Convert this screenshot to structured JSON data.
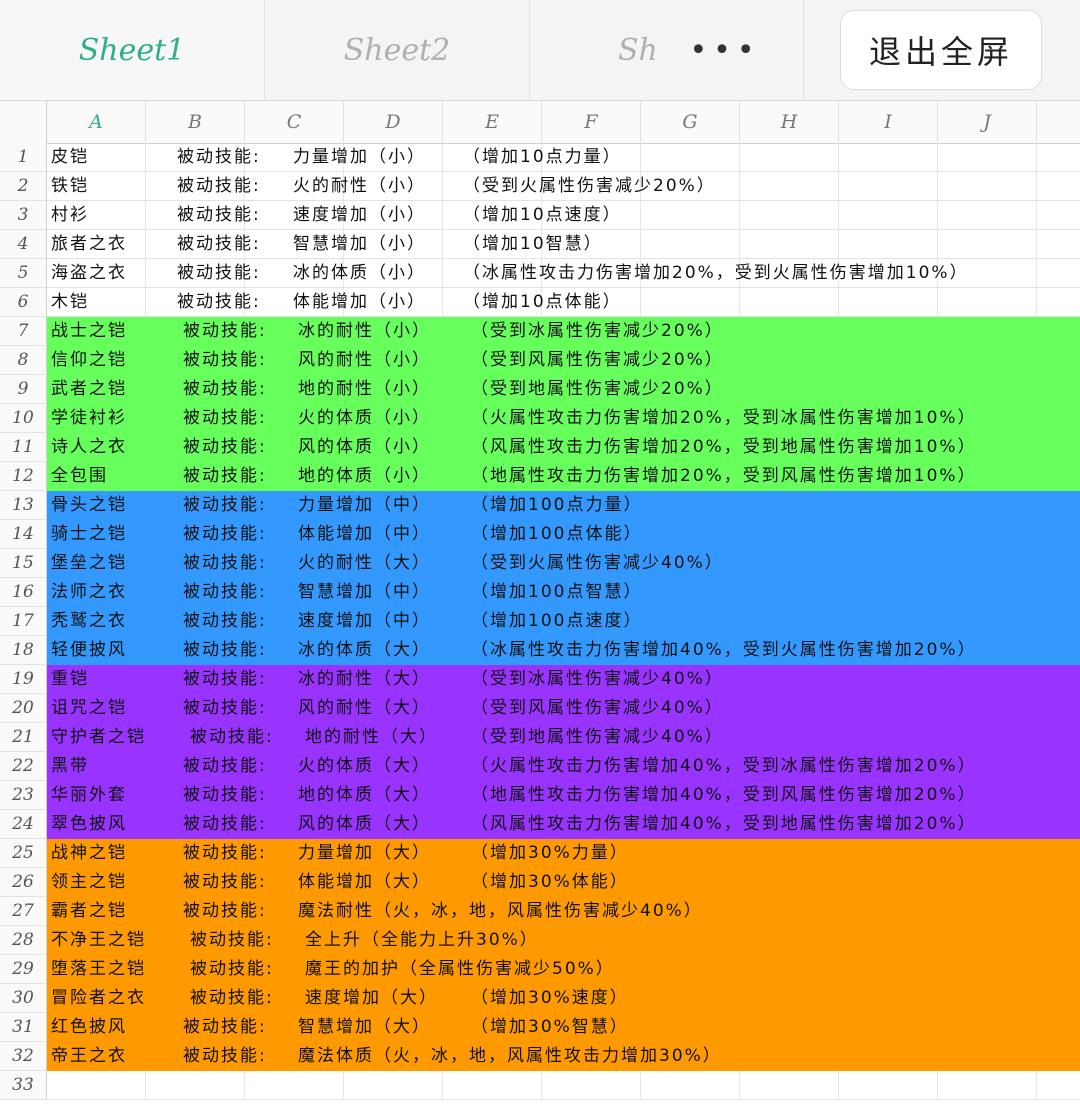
{
  "tabs": [
    {
      "label": "Sheet1",
      "active": true
    },
    {
      "label": "Sheet2",
      "active": false
    },
    {
      "label": "Sh",
      "active": false
    }
  ],
  "more_label": "•••",
  "exit_fullscreen_label": "退出全屏",
  "columns": [
    "A",
    "B",
    "C",
    "D",
    "E",
    "F",
    "G",
    "H",
    "I",
    "J"
  ],
  "colors": {
    "active_accent": "#2fae8c",
    "green": "#66ff5c",
    "blue": "#3399ff",
    "purple": "#9933ff",
    "orange": "#ff9900"
  },
  "rows": [
    {
      "num": "1",
      "name": "皮铠",
      "skill": "被动技能:",
      "effect": "力量增加（小）",
      "detail": "（增加10点力量）",
      "band": "none"
    },
    {
      "num": "2",
      "name": "铁铠",
      "skill": "被动技能:",
      "effect": "火的耐性（小）",
      "detail": "（受到火属性伤害减少20%）",
      "band": "none"
    },
    {
      "num": "3",
      "name": "村衫",
      "skill": "被动技能:",
      "effect": "速度增加（小）",
      "detail": "（增加10点速度）",
      "band": "none"
    },
    {
      "num": "4",
      "name": "旅者之衣",
      "skill": "被动技能:",
      "effect": "智慧增加（小）",
      "detail": "（增加10智慧）",
      "band": "none"
    },
    {
      "num": "5",
      "name": "海盗之衣",
      "skill": "被动技能:",
      "effect": "冰的体质（小）",
      "detail": "（冰属性攻击力伤害增加20%，受到火属性伤害增加10%）",
      "band": "none"
    },
    {
      "num": "6",
      "name": "木铠",
      "skill": "被动技能:",
      "effect": "体能增加（小）",
      "detail": "（增加10点体能）",
      "band": "none"
    },
    {
      "num": "7",
      "name": "战士之铠",
      "skill": "被动技能:",
      "effect": "冰的耐性（小）",
      "detail": "（受到冰属性伤害减少20%）",
      "band": "green"
    },
    {
      "num": "8",
      "name": "信仰之铠",
      "skill": "被动技能:",
      "effect": "风的耐性（小）",
      "detail": "（受到风属性伤害减少20%）",
      "band": "green"
    },
    {
      "num": "9",
      "name": "武者之铠",
      "skill": "被动技能:",
      "effect": "地的耐性（小）",
      "detail": "（受到地属性伤害减少20%）",
      "band": "green"
    },
    {
      "num": "10",
      "name": "学徒衬衫",
      "skill": "被动技能:",
      "effect": "火的体质（小）",
      "detail": "（火属性攻击力伤害增加20%，受到冰属性伤害增加10%）",
      "band": "green"
    },
    {
      "num": "11",
      "name": "诗人之衣",
      "skill": "被动技能:",
      "effect": "风的体质（小）",
      "detail": "（风属性攻击力伤害增加20%，受到地属性伤害增加10%）",
      "band": "green"
    },
    {
      "num": "12",
      "name": "全包围",
      "skill": "被动技能:",
      "effect": "地的体质（小）",
      "detail": "（地属性攻击力伤害增加20%，受到风属性伤害增加10%）",
      "band": "green"
    },
    {
      "num": "13",
      "name": "骨头之铠",
      "skill": "被动技能:",
      "effect": "力量增加（中）",
      "detail": "（增加100点力量）",
      "band": "blue"
    },
    {
      "num": "14",
      "name": "骑士之铠",
      "skill": "被动技能:",
      "effect": "体能增加（中）",
      "detail": "（增加100点体能）",
      "band": "blue"
    },
    {
      "num": "15",
      "name": "堡垒之铠",
      "skill": "被动技能:",
      "effect": "火的耐性（大）",
      "detail": "（受到火属性伤害减少40%）",
      "band": "blue"
    },
    {
      "num": "16",
      "name": "法师之衣",
      "skill": "被动技能:",
      "effect": "智慧增加（中）",
      "detail": "（增加100点智慧）",
      "band": "blue"
    },
    {
      "num": "17",
      "name": "秃鹫之衣",
      "skill": "被动技能:",
      "effect": "速度增加（中）",
      "detail": "（增加100点速度）",
      "band": "blue"
    },
    {
      "num": "18",
      "name": "轻便披风",
      "skill": "被动技能:",
      "effect": "冰的体质（大）",
      "detail": "（冰属性攻击力伤害增加40%，受到火属性伤害增加20%）",
      "band": "blue"
    },
    {
      "num": "19",
      "name": "重铠",
      "skill": "被动技能:",
      "effect": "冰的耐性（大）",
      "detail": "（受到冰属性伤害减少40%）",
      "band": "purple"
    },
    {
      "num": "20",
      "name": "诅咒之铠",
      "skill": "被动技能:",
      "effect": "风的耐性（大）",
      "detail": "（受到风属性伤害减少40%）",
      "band": "purple"
    },
    {
      "num": "21",
      "name": "守护者之铠",
      "skill": "被动技能:",
      "effect": "地的耐性（大）",
      "detail": "（受到地属性伤害减少40%）",
      "band": "purple"
    },
    {
      "num": "22",
      "name": "黑带",
      "skill": "被动技能:",
      "effect": "火的体质（大）",
      "detail": "（火属性攻击力伤害增加40%，受到冰属性伤害增加20%）",
      "band": "purple"
    },
    {
      "num": "23",
      "name": "华丽外套",
      "skill": "被动技能:",
      "effect": "地的体质（大）",
      "detail": "（地属性攻击力伤害增加40%，受到风属性伤害增加20%）",
      "band": "purple"
    },
    {
      "num": "24",
      "name": "翠色披风",
      "skill": "被动技能:",
      "effect": "风的体质（大）",
      "detail": "（风属性攻击力伤害增加40%，受到地属性伤害增加20%）",
      "band": "purple"
    },
    {
      "num": "25",
      "name": "战神之铠",
      "skill": "被动技能:",
      "effect": "力量增加（大）",
      "detail": "（增加30%力量）",
      "band": "orange"
    },
    {
      "num": "26",
      "name": "领主之铠",
      "skill": "被动技能:",
      "effect": "体能增加（大）",
      "detail": "（增加30%体能）",
      "band": "orange"
    },
    {
      "num": "27",
      "name": "霸者之铠",
      "skill": "被动技能:",
      "effect": "魔法耐性（火，冰，地，风属性伤害减少40%）",
      "detail": "",
      "band": "orange"
    },
    {
      "num": "28",
      "name": "不净王之铠",
      "skill": "被动技能:",
      "effect": "全上升（全能力上升30%）",
      "detail": "",
      "band": "orange"
    },
    {
      "num": "29",
      "name": "堕落王之铠",
      "skill": "被动技能:",
      "effect": "魔王的加护（全属性伤害减少50%）",
      "detail": "",
      "band": "orange"
    },
    {
      "num": "30",
      "name": "冒险者之衣",
      "skill": "被动技能:",
      "effect": "速度增加（大）",
      "detail": "（增加30%速度）",
      "band": "orange"
    },
    {
      "num": "31",
      "name": "红色披风",
      "skill": "被动技能:",
      "effect": "智慧增加（大）",
      "detail": "（增加30%智慧）",
      "band": "orange"
    },
    {
      "num": "32",
      "name": "帝王之衣",
      "skill": "被动技能:",
      "effect": "魔法体质（火，冰，地，风属性攻击力增加30%）",
      "detail": "",
      "band": "orange"
    },
    {
      "num": "33",
      "name": "",
      "skill": "",
      "effect": "",
      "detail": "",
      "band": "none"
    }
  ]
}
